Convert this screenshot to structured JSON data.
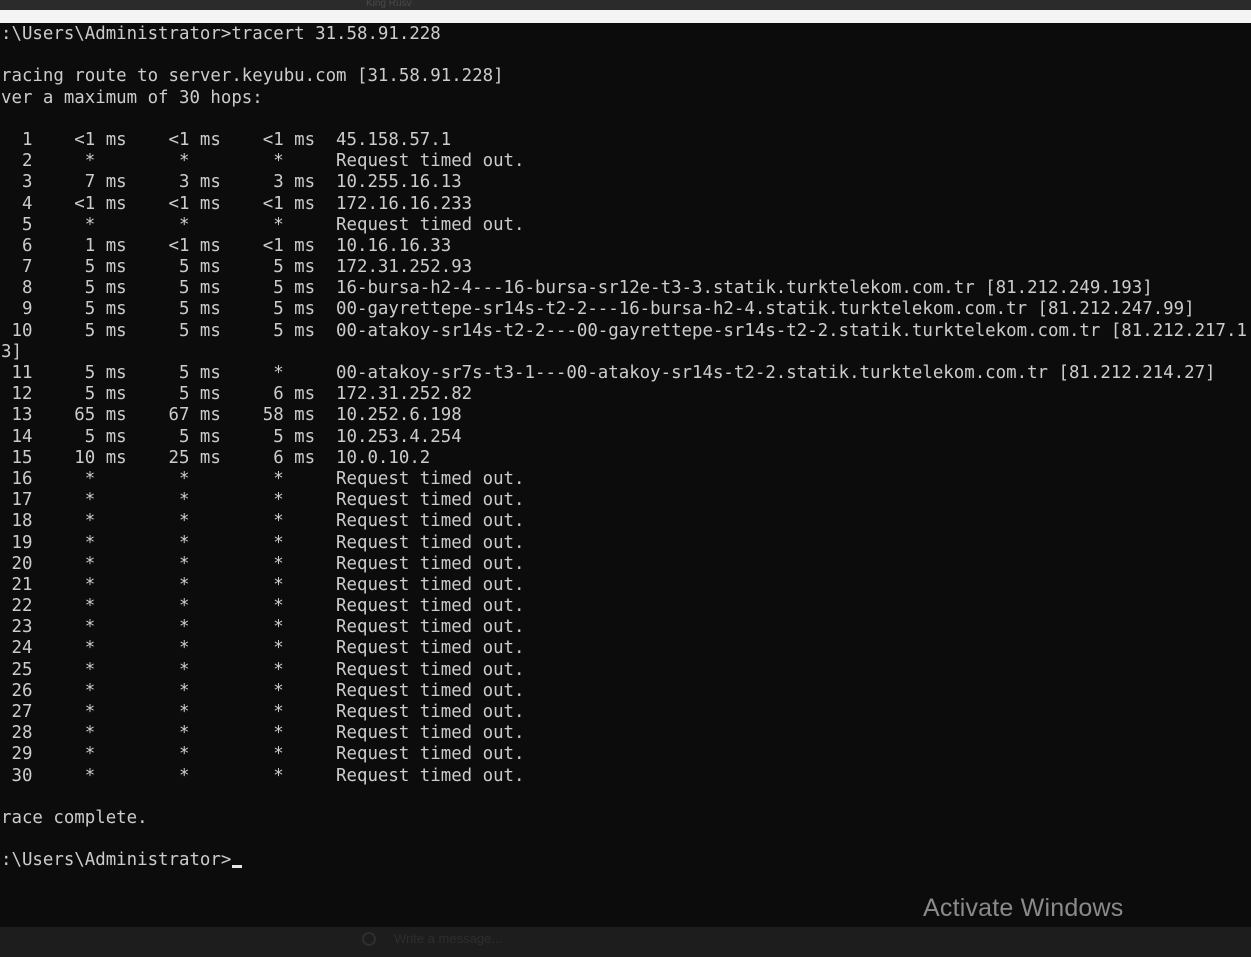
{
  "window": {
    "title_fragment": "King Rusv"
  },
  "console": {
    "lines": [
      ":\\Users\\Administrator>tracert 31.58.91.228",
      "",
      "racing route to server.keyubu.com [31.58.91.228]",
      "ver a maximum of 30 hops:",
      "",
      "  1    <1 ms    <1 ms    <1 ms  45.158.57.1",
      "  2     *        *        *     Request timed out.",
      "  3     7 ms     3 ms     3 ms  10.255.16.13",
      "  4    <1 ms    <1 ms    <1 ms  172.16.16.233",
      "  5     *        *        *     Request timed out.",
      "  6     1 ms    <1 ms    <1 ms  10.16.16.33",
      "  7     5 ms     5 ms     5 ms  172.31.252.93",
      "  8     5 ms     5 ms     5 ms  16-bursa-h2-4---16-bursa-sr12e-t3-3.statik.turktelekom.com.tr [81.212.249.193]",
      "  9     5 ms     5 ms     5 ms  00-gayrettepe-sr14s-t2-2---16-bursa-h2-4.statik.turktelekom.com.tr [81.212.247.99]",
      " 10     5 ms     5 ms     5 ms  00-atakoy-sr14s-t2-2---00-gayrettepe-sr14s-t2-2.statik.turktelekom.com.tr [81.212.217.1",
      "3]",
      " 11     5 ms     5 ms     *     00-atakoy-sr7s-t3-1---00-atakoy-sr14s-t2-2.statik.turktelekom.com.tr [81.212.214.27]",
      " 12     5 ms     5 ms     6 ms  172.31.252.82",
      " 13    65 ms    67 ms    58 ms  10.252.6.198",
      " 14     5 ms     5 ms     5 ms  10.253.4.254",
      " 15    10 ms    25 ms     6 ms  10.0.10.2",
      " 16     *        *        *     Request timed out.",
      " 17     *        *        *     Request timed out.",
      " 18     *        *        *     Request timed out.",
      " 19     *        *        *     Request timed out.",
      " 20     *        *        *     Request timed out.",
      " 21     *        *        *     Request timed out.",
      " 22     *        *        *     Request timed out.",
      " 23     *        *        *     Request timed out.",
      " 24     *        *        *     Request timed out.",
      " 25     *        *        *     Request timed out.",
      " 26     *        *        *     Request timed out.",
      " 27     *        *        *     Request timed out.",
      " 28     *        *        *     Request timed out.",
      " 29     *        *        *     Request timed out.",
      " 30     *        *        *     Request timed out.",
      "",
      "race complete.",
      ""
    ],
    "prompt": ":\\Users\\Administrator>"
  },
  "watermark": {
    "text": "Activate Windows"
  },
  "taskbar": {
    "ghost_text": "Write a message..."
  },
  "colors": {
    "background": "#0c0c0c",
    "text": "#cccccc",
    "watermark": "#8a8a8a"
  }
}
